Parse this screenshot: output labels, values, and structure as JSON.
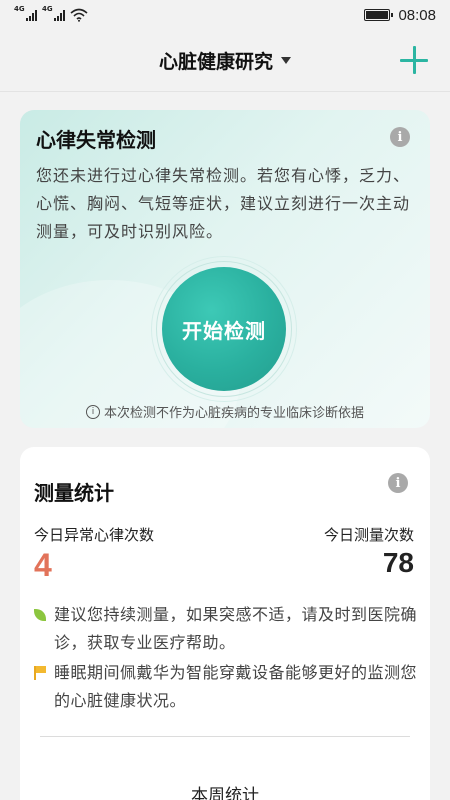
{
  "status_bar": {
    "signal1_tag": "4G",
    "signal2_tag": "4G",
    "time": "08:08"
  },
  "header": {
    "title": "心脏健康研究"
  },
  "arrhythmia_card": {
    "title": "心律失常检测",
    "description": "您还未进行过心律失常检测。若您有心悸，乏力、心慌、胸闷、气短等症状，建议立刻进行一次主动测量，可及时识别风险。",
    "start_button": "开始检测",
    "disclaimer": "本次检测不作为心脏疾病的专业临床诊断依据"
  },
  "stats_card": {
    "title": "测量统计",
    "abnormal_label": "今日异常心律次数",
    "abnormal_value": "4",
    "count_label": "今日测量次数",
    "count_value": "78",
    "tip1": "建议您持续测量，如果突感不适，请及时到医院确诊，获取专业医疗帮助。",
    "tip2": "睡眠期间佩戴华为智能穿戴设备能够更好的监测您的心脏健康状况。",
    "week_label": "本周统计"
  },
  "colors": {
    "accent": "#2bb5a2",
    "abnormal": "#e2735a"
  }
}
